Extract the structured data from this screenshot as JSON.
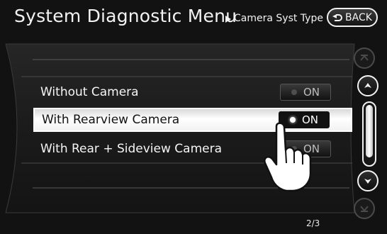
{
  "header": {
    "title": "System Diagnostic Menu",
    "breadcrumb": "Camera Syst Type",
    "back_label": "BACK"
  },
  "options": [
    {
      "label": "Without Camera",
      "state": "ON",
      "active": false,
      "highlighted": false
    },
    {
      "label": "With Rearview Camera",
      "state": "ON",
      "active": true,
      "highlighted": true
    },
    {
      "label": "With Rear + Sideview Camera",
      "state": "ON",
      "active": false,
      "highlighted": false
    }
  ],
  "scroll": {
    "page": "2/3",
    "thumb_fraction": 0.9,
    "icons": [
      "page-up-icon",
      "scroll-up-icon",
      "scroll-down-icon",
      "page-down-icon"
    ]
  },
  "overlay": {
    "icon": "pointing-hand-icon"
  },
  "colors": {
    "background": "#121212",
    "text": "#f2f2f2",
    "selected_row": "#ffffff",
    "indicator_on": "#ffffff",
    "indicator_off": "#4e4e4e"
  }
}
